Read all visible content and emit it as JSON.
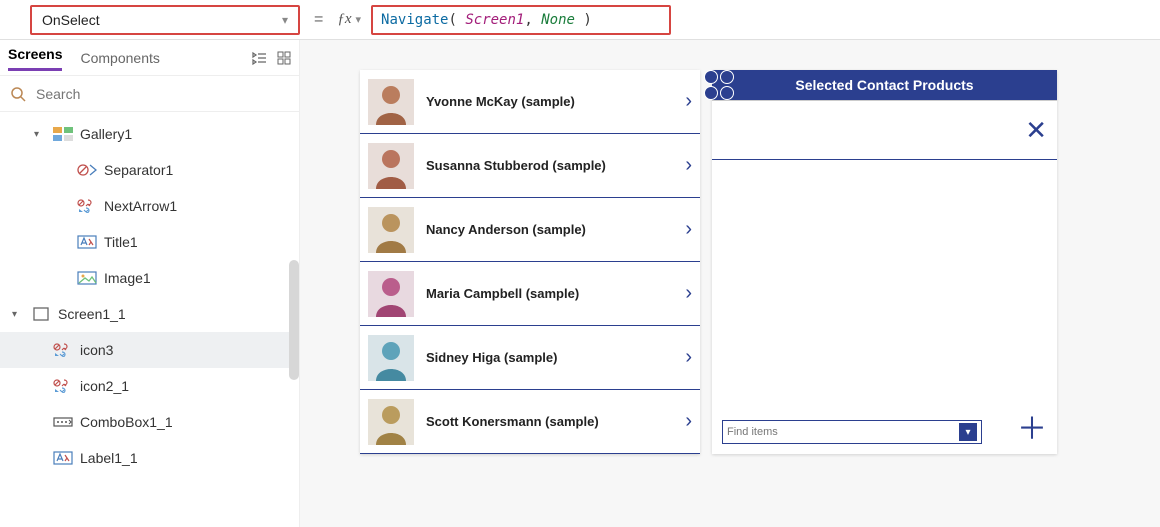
{
  "formula": {
    "property": "OnSelect",
    "fn": "Navigate",
    "arg1": "Screen1",
    "arg2": "None"
  },
  "left": {
    "tabs": {
      "screens": "Screens",
      "components": "Components"
    },
    "search_placeholder": "Search",
    "items": [
      {
        "label": "Gallery1",
        "indent": 1,
        "icon": "gallery"
      },
      {
        "label": "Separator1",
        "indent": 2,
        "icon": "separator"
      },
      {
        "label": "NextArrow1",
        "indent": 2,
        "icon": "statectrl"
      },
      {
        "label": "Title1",
        "indent": 2,
        "icon": "label"
      },
      {
        "label": "Image1",
        "indent": 2,
        "icon": "image"
      },
      {
        "label": "Screen1_1",
        "indent": 0,
        "icon": "screen",
        "expandable": true
      },
      {
        "label": "icon3",
        "indent": 1,
        "icon": "statectrl",
        "selected": true
      },
      {
        "label": "icon2_1",
        "indent": 1,
        "icon": "statectrl"
      },
      {
        "label": "ComboBox1_1",
        "indent": 1,
        "icon": "combobox"
      },
      {
        "label": "Label1_1",
        "indent": 1,
        "icon": "label"
      }
    ]
  },
  "gallery": {
    "rows": [
      {
        "name": "Yvonne McKay (sample)",
        "hue": 20
      },
      {
        "name": "Susanna Stubberod (sample)",
        "hue": 15
      },
      {
        "name": "Nancy Anderson (sample)",
        "hue": 35
      },
      {
        "name": "Maria Campbell (sample)",
        "hue": 330
      },
      {
        "name": "Sidney Higa (sample)",
        "hue": 195
      },
      {
        "name": "Scott Konersmann (sample)",
        "hue": 40
      }
    ]
  },
  "detail": {
    "title": "Selected Contact Products",
    "combo_placeholder": "Find items"
  }
}
